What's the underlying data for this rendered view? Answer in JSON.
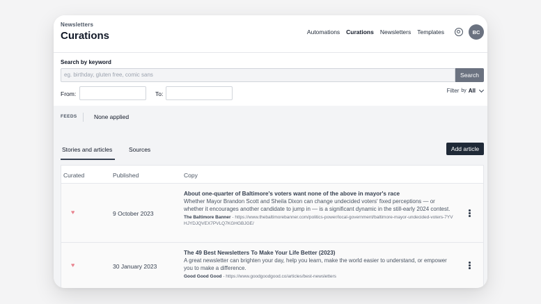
{
  "header": {
    "breadcrumb": "Newsletters",
    "title": "Curations",
    "nav": [
      "Automations",
      "Curations",
      "Newsletters",
      "Templates"
    ],
    "active_nav": "Curations",
    "avatar_initials": "BC"
  },
  "search": {
    "label": "Search by keyword",
    "placeholder": "eg. birthday, gluten free, comic sans",
    "button": "Search",
    "from_label": "From:",
    "to_label": "To:",
    "filter_label": "Filter",
    "filter_by": "by",
    "filter_value": "All"
  },
  "feeds": {
    "label": "FEEDS",
    "value": "None applied"
  },
  "tabs": [
    "Stories and articles",
    "Sources"
  ],
  "add_article": "Add article",
  "table": {
    "columns": [
      "Curated",
      "Published",
      "Copy"
    ],
    "rows": [
      {
        "date": "9 October 2023",
        "title": "About one-quarter of Baltimore's voters want none of the above in mayor's race",
        "description": "Whether Mayor Brandon Scott and Sheila Dixon can change undecided voters' fixed perceptions — or whether it encourages another candidate to jump in — is a significant dynamic in the still-early 2024 contest.",
        "source_name": "The Baltimore Banner",
        "source_url": " - https://www.thebaltimorebanner.com/politics-power/local-government/baltimore-mayor-undecided-voters-7YVHJYDJQVEX7PVLQ7KGHGBJGE/"
      },
      {
        "date": "30 January 2023",
        "title": "The 49 Best Newsletters To Make Your Life Better (2023)",
        "description": "A great newsletter can brighten your day, help you learn, make the world easier to understand, or empower you to make a difference.",
        "source_name": "Good Good Good",
        "source_url": " - https://www.goodgoodgood.co/articles/best-newsletters"
      }
    ]
  }
}
